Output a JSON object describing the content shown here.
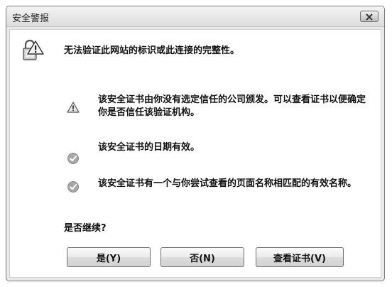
{
  "window": {
    "title": "安全警报"
  },
  "dialog": {
    "headline": "无法验证此网站的标识或此连接的完整性。",
    "items": [
      {
        "icon": "warning-icon",
        "text": "该安全证书由你没有选定信任的公司颁发。可以查看证书以便确定你是否信任该验证机构。"
      },
      {
        "icon": "check-icon",
        "text": "该安全证书的日期有效。"
      },
      {
        "icon": "check-icon",
        "text": "该安全证书有一个与你尝试查看的页面名称相匹配的有效名称。"
      }
    ],
    "question": "是否继续?"
  },
  "buttons": {
    "yes_label": "是(Y)",
    "no_label": "否(N)",
    "view_cert_label": "查看证书(V)"
  },
  "colors": {
    "window_frame": "#e9e9e9",
    "content_bg": "#ffffff",
    "icon_gray": "#9a9a9a"
  }
}
